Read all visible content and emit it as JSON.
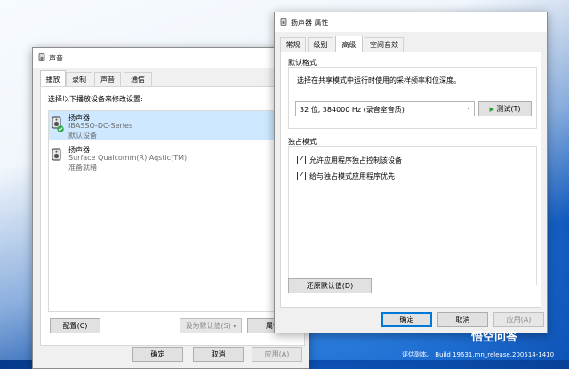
{
  "sound_dialog": {
    "title": "声音",
    "tabs": [
      {
        "label": "播放",
        "active": true
      },
      {
        "label": "录制",
        "active": false
      },
      {
        "label": "声音",
        "active": false
      },
      {
        "label": "通信",
        "active": false
      }
    ],
    "instruction": "选择以下播放设备来修改设置:",
    "devices": [
      {
        "name": "扬声器",
        "model": "IBASSO-DC-Series",
        "status": "默认设备",
        "selected": true,
        "default": true
      },
      {
        "name": "扬声器",
        "model": "Surface Qualcomm(R) Aqstic(TM)",
        "status": "准备就绪",
        "selected": false,
        "default": false
      }
    ],
    "configure_label": "配置(C)",
    "set_default_label": "设为默认值(S)",
    "properties_label": "属性",
    "ok_label": "确定",
    "cancel_label": "取消",
    "apply_label": "应用(A)"
  },
  "properties_dialog": {
    "title": "扬声器 属性",
    "tabs": [
      {
        "label": "常规",
        "active": false
      },
      {
        "label": "级别",
        "active": false
      },
      {
        "label": "高级",
        "active": true
      },
      {
        "label": "空间音效",
        "active": false
      }
    ],
    "default_format": {
      "group_label": "默认格式",
      "description": "选择在共享模式中运行时使用的采样频率和位深度。",
      "selected_format": "32 位, 384000 Hz (录音室音质)",
      "test_label": "测试(T)"
    },
    "exclusive_mode": {
      "group_label": "独占模式",
      "options": [
        {
          "label": "允许应用程序独占控制该设备",
          "checked": true
        },
        {
          "label": "给与独占模式应用程序优先",
          "checked": true
        }
      ]
    },
    "restore_defaults_label": "还原默认值(D)",
    "ok_label": "确定",
    "cancel_label": "取消",
    "apply_label": "应用(A)"
  },
  "desktop": {
    "eval_text": "评估副本。 Build 19631.mn_release.200514-1410",
    "watermark_text": "悟空问答"
  },
  "colors": {
    "accent": "#0078d7",
    "selection": "#cde8ff",
    "test_arrow": "#2e9e2e",
    "default_check": "#2fa84f"
  }
}
